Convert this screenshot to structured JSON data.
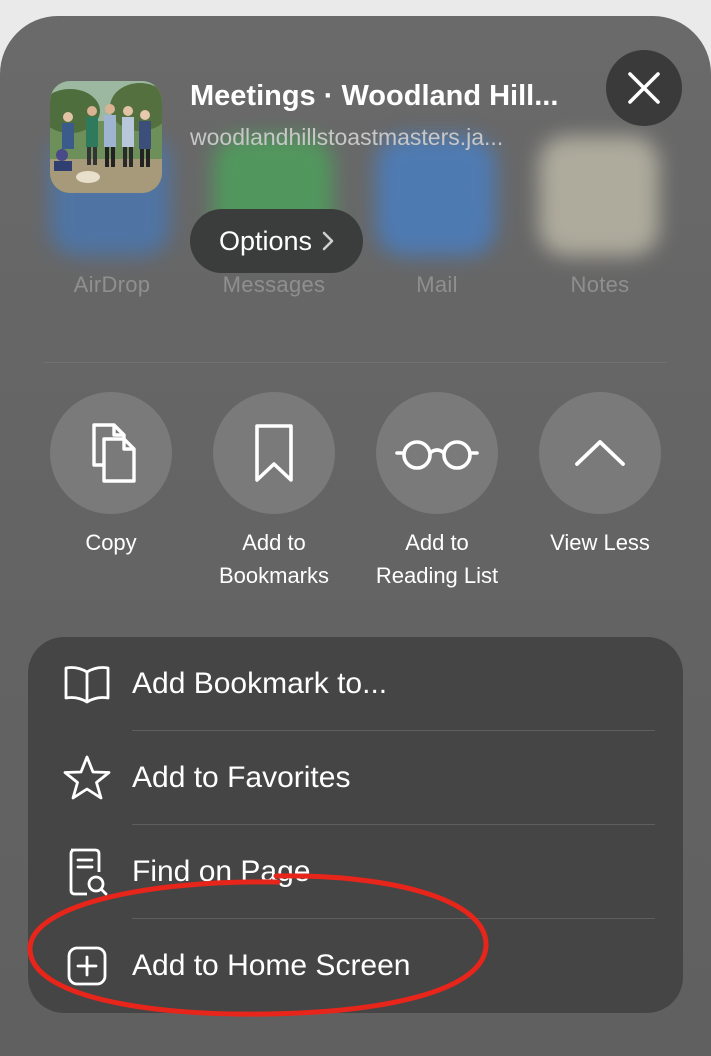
{
  "header": {
    "title": "Meetings · Woodland Hill...",
    "url": "woodlandhillstoastmasters.ja...",
    "options_label": "Options"
  },
  "share_targets": [
    {
      "label": "AirDrop",
      "icon": "airdrop-icon"
    },
    {
      "label": "Messages",
      "icon": "messages-icon"
    },
    {
      "label": "Mail",
      "icon": "mail-icon"
    },
    {
      "label": "Notes",
      "icon": "notes-icon"
    }
  ],
  "actions": [
    {
      "label": "Copy",
      "icon": "copy-icon"
    },
    {
      "label": "Add to\nBookmarks",
      "icon": "bookmark-icon"
    },
    {
      "label": "Add to\nReading List",
      "icon": "glasses-icon"
    },
    {
      "label": "View Less",
      "icon": "chevron-up-icon"
    }
  ],
  "menu": [
    {
      "label": "Add Bookmark to...",
      "icon": "book-icon"
    },
    {
      "label": "Add to Favorites",
      "icon": "star-icon"
    },
    {
      "label": "Find on Page",
      "icon": "find-on-page-icon"
    },
    {
      "label": "Add to Home Screen",
      "icon": "add-square-icon"
    }
  ],
  "colors": {
    "annotation_circle": "#e8251a",
    "menu_background": "#454545"
  }
}
